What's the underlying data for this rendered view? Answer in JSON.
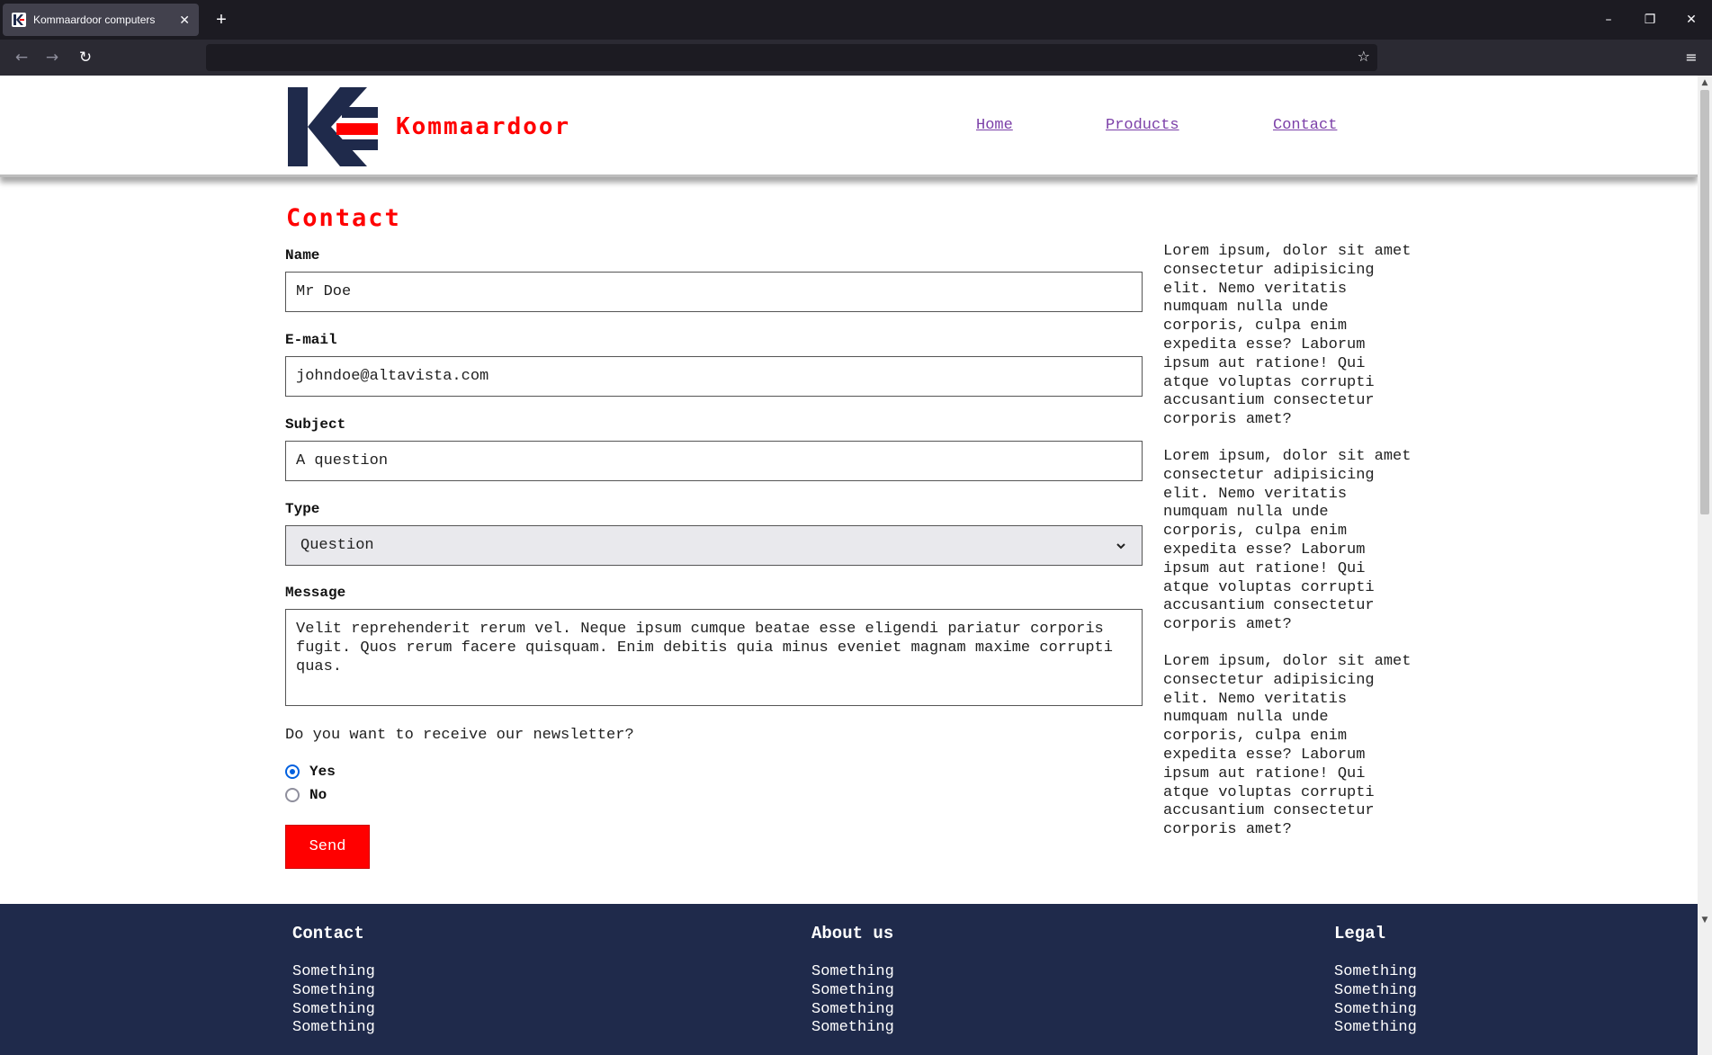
{
  "browser": {
    "tab_title": "Kommaardoor computers",
    "new_tab_icon": "+",
    "url": "",
    "window_controls": {
      "minimize": "–",
      "restore": "❐",
      "close": "✕"
    }
  },
  "site": {
    "brand": "Kommaardoor",
    "nav": [
      "Home",
      "Products",
      "Contact"
    ],
    "colors": {
      "accent": "#ff0000",
      "navy": "#1f2a4b",
      "link": "#7b3fa8"
    }
  },
  "form": {
    "title": "Contact",
    "name_label": "Name",
    "name_value": "Mr Doe",
    "email_label": "E-mail",
    "email_value": "johndoe@altavista.com",
    "subject_label": "Subject",
    "subject_value": "A question",
    "type_label": "Type",
    "type_selected": "Question",
    "message_label": "Message",
    "message_value": "Velit reprehenderit rerum vel. Neque ipsum cumque beatae esse eligendi pariatur corporis fugit. Quos rerum facere quisquam. Enim debitis quia minus eveniet magnam maxime corrupti quas.",
    "newsletter_question": "Do you want to receive our newsletter?",
    "radio_yes": "Yes",
    "radio_no": "No",
    "newsletter_selected": "Yes",
    "send_label": "Send"
  },
  "aside": {
    "paragraphs": [
      "Lorem ipsum, dolor sit amet consectetur adipisicing elit. Nemo veritatis numquam nulla unde corporis, culpa enim expedita esse? Laborum ipsum aut ratione! Qui atque voluptas corrupti accusantium consectetur corporis amet?",
      "Lorem ipsum, dolor sit amet consectetur adipisicing elit. Nemo veritatis numquam nulla unde corporis, culpa enim expedita esse? Laborum ipsum aut ratione! Qui atque voluptas corrupti accusantium consectetur corporis amet?",
      "Lorem ipsum, dolor sit amet consectetur adipisicing elit. Nemo veritatis numquam nulla unde corporis, culpa enim expedita esse? Laborum ipsum aut ratione! Qui atque voluptas corrupti accusantium consectetur corporis amet?"
    ]
  },
  "footer": {
    "columns": [
      {
        "heading": "Contact",
        "links": [
          "Something",
          "Something",
          "Something",
          "Something"
        ]
      },
      {
        "heading": "About us",
        "links": [
          "Something",
          "Something",
          "Something",
          "Something"
        ]
      },
      {
        "heading": "Legal",
        "links": [
          "Something",
          "Something",
          "Something",
          "Something"
        ]
      }
    ]
  }
}
